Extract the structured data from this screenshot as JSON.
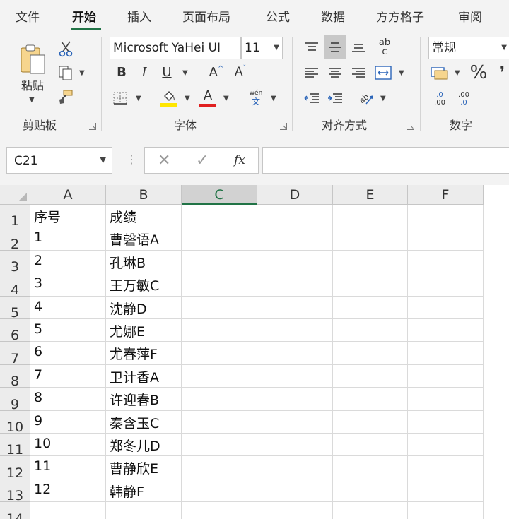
{
  "tabs": [
    "文件",
    "开始",
    "插入",
    "页面布局",
    "公式",
    "数据",
    "方方格子",
    "审阅"
  ],
  "active_tab": "开始",
  "accent_color": "#217346",
  "clipboard": {
    "paste_label": "粘贴",
    "group_label": "剪贴板"
  },
  "font": {
    "name": "Microsoft YaHei UI",
    "size": "11",
    "group_label": "字体",
    "bold": "B",
    "italic": "I",
    "underline": "U",
    "grow": "A",
    "shrink": "A",
    "font_color_glyph": "A",
    "phonetic_top": "wén",
    "phonetic_bottom": "文",
    "font_color": "#e02020",
    "fill_color": "#ffe600"
  },
  "alignment": {
    "group_label": "对齐方式",
    "wrap_top": "ab",
    "wrap_bottom": "c"
  },
  "number": {
    "format": "常规",
    "group_label": "数字",
    "percent": "%",
    "comma": "❜",
    "inc_top": ".0",
    "inc_bottom": ".00",
    "dec_top": ".00",
    "dec_bottom": ".0"
  },
  "formula_bar": {
    "name_box": "C21",
    "cancel": "✕",
    "enter": "✓",
    "fx": "fx",
    "dots": "⋮",
    "content": ""
  },
  "columns": [
    "A",
    "B",
    "C",
    "D",
    "E",
    "F"
  ],
  "selected_column": "C",
  "rows": [
    {
      "n": "1",
      "a": "序号",
      "b": "成绩"
    },
    {
      "n": "2",
      "a": "1",
      "b": "曹磬语A"
    },
    {
      "n": "3",
      "a": "2",
      "b": "孔琳B"
    },
    {
      "n": "4",
      "a": "3",
      "b": "王万敏C"
    },
    {
      "n": "5",
      "a": "4",
      "b": "沈静D"
    },
    {
      "n": "6",
      "a": "5",
      "b": "尤娜E"
    },
    {
      "n": "7",
      "a": "6",
      "b": "尤春萍F"
    },
    {
      "n": "8",
      "a": "7",
      "b": "卫计香A"
    },
    {
      "n": "9",
      "a": "8",
      "b": "许迎春B"
    },
    {
      "n": "10",
      "a": "9",
      "b": "秦含玉C"
    },
    {
      "n": "11",
      "a": "10",
      "b": "郑冬儿D"
    },
    {
      "n": "12",
      "a": "11",
      "b": "曹静欣E"
    },
    {
      "n": "13",
      "a": "12",
      "b": "韩静F"
    },
    {
      "n": "14",
      "a": "",
      "b": ""
    }
  ]
}
